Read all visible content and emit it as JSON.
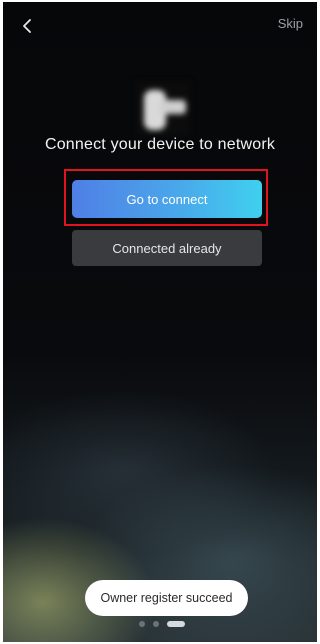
{
  "header": {
    "back_icon": "chevron-left-icon",
    "skip_label": "Skip"
  },
  "main": {
    "device_image": "device-image",
    "title": "Connect your device to network",
    "primary_button_label": "Go to connect",
    "secondary_button_label": "Connected already"
  },
  "toast": {
    "message": "Owner register succeed"
  },
  "pager": {
    "page_count": 3,
    "active_index": 2
  },
  "colors": {
    "background": "#090a0d",
    "primary_gradient_start": "#4f7fe6",
    "primary_gradient_end": "#3fd0ef",
    "secondary_button": "#3a3b3f",
    "highlight_frame": "#e0141e"
  }
}
